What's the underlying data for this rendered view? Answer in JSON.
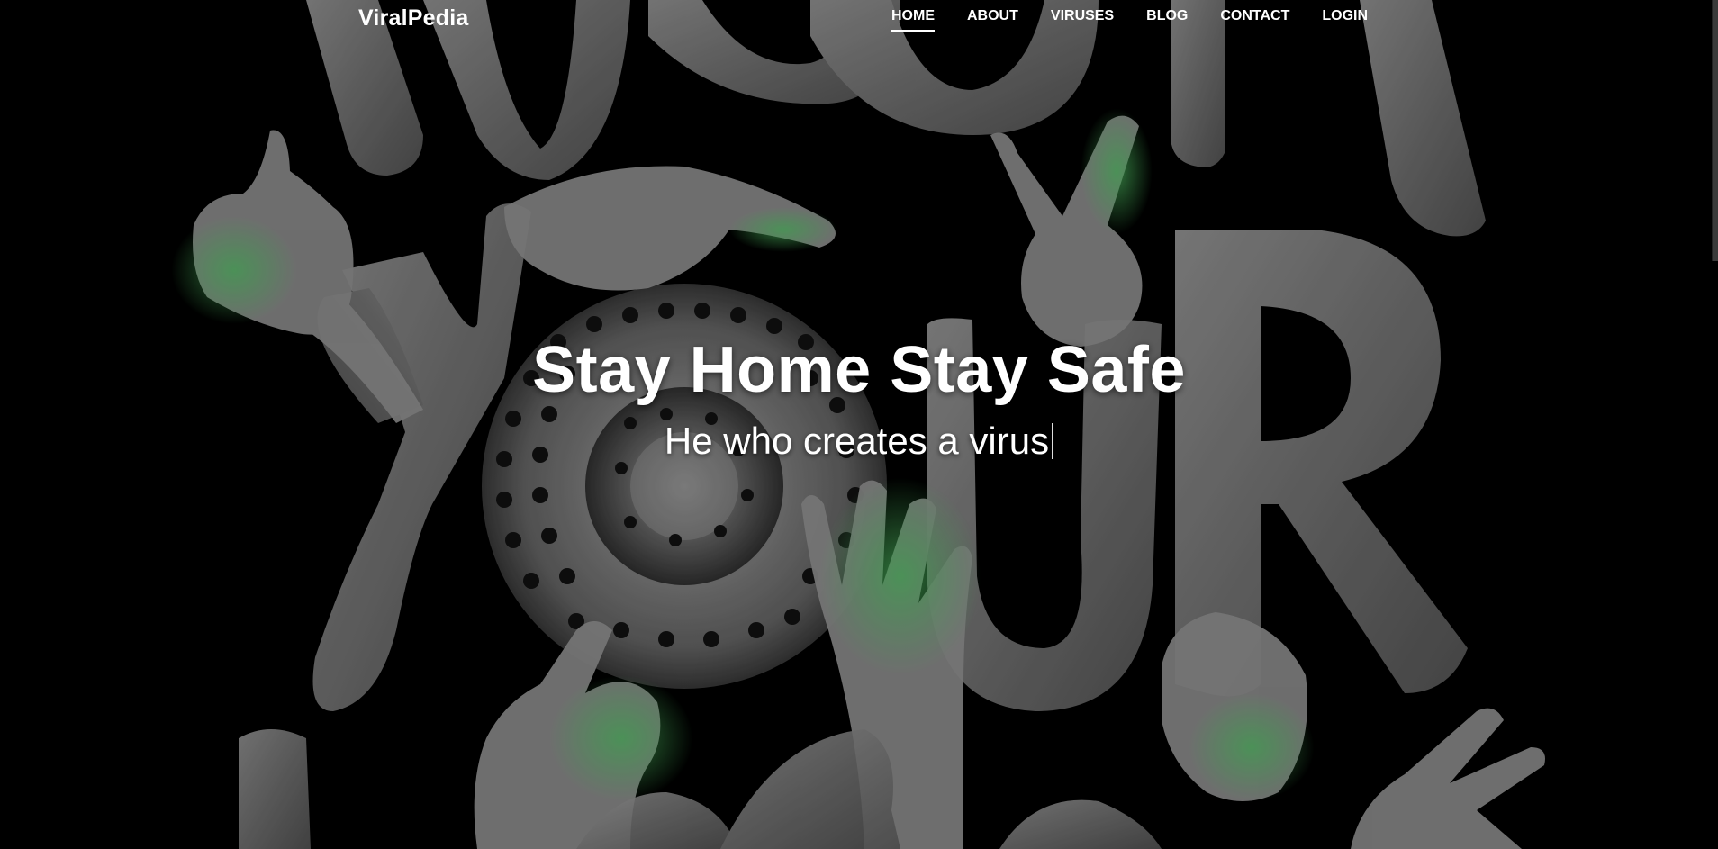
{
  "navbar": {
    "brand": "ViralPedia",
    "links": [
      {
        "label": "HOME",
        "active": true
      },
      {
        "label": "ABOUT",
        "active": false
      },
      {
        "label": "VIRUSES",
        "active": false
      },
      {
        "label": "BLOG",
        "active": false
      },
      {
        "label": "CONTACT",
        "active": false
      },
      {
        "label": "LOGIN",
        "active": false
      }
    ]
  },
  "hero": {
    "title": "Stay Home Stay Safe",
    "subtitle": "He who creates a virus"
  },
  "colors": {
    "background": "#000000",
    "letter_gray": "#8a8a8a",
    "hand_gray": "#9a9a9a",
    "green_tint": "#3fae5a",
    "text": "#ffffff"
  },
  "icons": {
    "background_art": "wash-your-hands-illustration"
  }
}
